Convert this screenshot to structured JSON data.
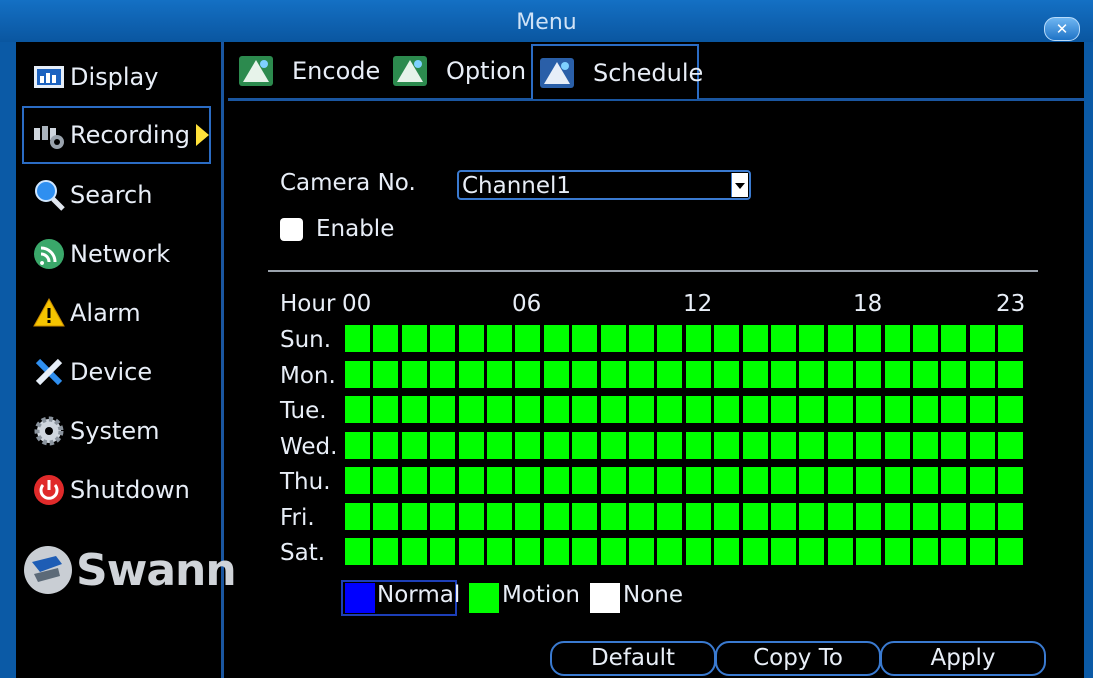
{
  "window": {
    "title": "Menu"
  },
  "sidebar": {
    "items": [
      {
        "label": "Display",
        "icon": "display-icon"
      },
      {
        "label": "Recording",
        "icon": "recording-icon"
      },
      {
        "label": "Search",
        "icon": "search-icon"
      },
      {
        "label": "Network",
        "icon": "network-icon"
      },
      {
        "label": "Alarm",
        "icon": "alarm-icon"
      },
      {
        "label": "Device",
        "icon": "device-icon"
      },
      {
        "label": "System",
        "icon": "system-icon"
      },
      {
        "label": "Shutdown",
        "icon": "shutdown-icon"
      }
    ],
    "active": "Recording",
    "logo": "Swann"
  },
  "tabs": [
    {
      "label": "Encode"
    },
    {
      "label": "Option"
    },
    {
      "label": "Schedule"
    }
  ],
  "active_tab": "Schedule",
  "schedule": {
    "camera_label": "Camera No.",
    "camera_value": "Channel1",
    "enable_label": "Enable",
    "enable_checked": false,
    "hour_label": "Hour",
    "hour_ticks": [
      "00",
      "06",
      "12",
      "18",
      "23"
    ],
    "days": [
      "Sun.",
      "Mon.",
      "Tue.",
      "Wed.",
      "Thu.",
      "Fri.",
      "Sat."
    ],
    "hours_per_day": 24,
    "cell_mode": "Motion"
  },
  "legend": [
    {
      "label": "Normal",
      "color": "#0000ff"
    },
    {
      "label": "Motion",
      "color": "#00ff00"
    },
    {
      "label": "None",
      "color": "#ffffff"
    }
  ],
  "buttons": {
    "default": "Default",
    "copy_to": "Copy To",
    "apply": "Apply"
  }
}
